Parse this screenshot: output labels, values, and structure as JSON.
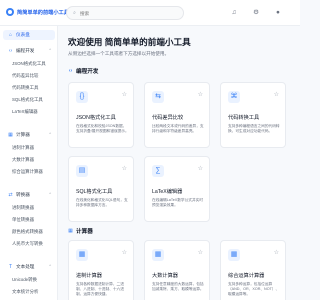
{
  "header": {
    "site_name": "简简单单的前端小工具",
    "search_placeholder": "搜索",
    "icons": [
      "menu-icon",
      "search-icon",
      "bell-icon",
      "settings-icon",
      "user-icon"
    ]
  },
  "sidebar": {
    "home": "仪表盘",
    "categories": [
      {
        "label": "编程开发",
        "items": [
          "JSON格式化工具",
          "代码差异比较",
          "代码转换工具",
          "SQL格式化工具",
          "LaTeX编辑器"
        ]
      },
      {
        "label": "计算器",
        "items": [
          "进制计算器",
          "大数计算器",
          "综合运算计算器"
        ]
      },
      {
        "label": "转换器",
        "items": [
          "进制转换器",
          "单位转换器",
          "颜色格式转换器",
          "人民币大写转换"
        ]
      },
      {
        "label": "文本处理",
        "items": [
          "Unicode转换",
          "文本统计分析"
        ]
      }
    ]
  },
  "main": {
    "title": "欢迎使用 简简单单的前端小工具",
    "subtitle": "从侧边栏选择一个工具或者下方选择以开始使用。",
    "sections": [
      {
        "label": "编程开发",
        "cards": [
          {
            "icon": "braces-icon",
            "title": "JSON格式化工具",
            "desc": "在线格式化和校验JSON数据，支持折叠/展开视图和错误提示。"
          },
          {
            "icon": "diff-icon",
            "title": "代码差异比较",
            "desc": "比较两段文本或代码的差异，支持行级和字符级差异高亮。"
          },
          {
            "icon": "code-convert-icon",
            "title": "代码转换工具",
            "desc": "支持多种编程语言之间的代码转换，可生成对应功能代码。"
          },
          {
            "icon": "database-icon",
            "title": "SQL格式化工具",
            "desc": "在线美化和格式化SQL语句，支持多种数据库方言。"
          },
          {
            "icon": "formula-icon",
            "title": "LaTeX编辑器",
            "desc": "在线编辑LaTeX数学公式并实时预览渲染效果。"
          }
        ]
      },
      {
        "label": "计算器",
        "cards": [
          {
            "icon": "calculator-icon",
            "title": "进制计算器",
            "desc": "支持各种数据进制计算，二进制、八进制、十进制、十六进制，运算方便快捷。"
          },
          {
            "icon": "big-number-icon",
            "title": "大数计算器",
            "desc": "支持任意精度的大数运算，包括加减乘除、乘方、取模等运算。"
          },
          {
            "icon": "calculator-icon",
            "title": "综合运算计算器",
            "desc": "支持多种运算，包括位运算（AND、OR、XOR、NOT）、取模运算等。"
          }
        ]
      }
    ]
  }
}
